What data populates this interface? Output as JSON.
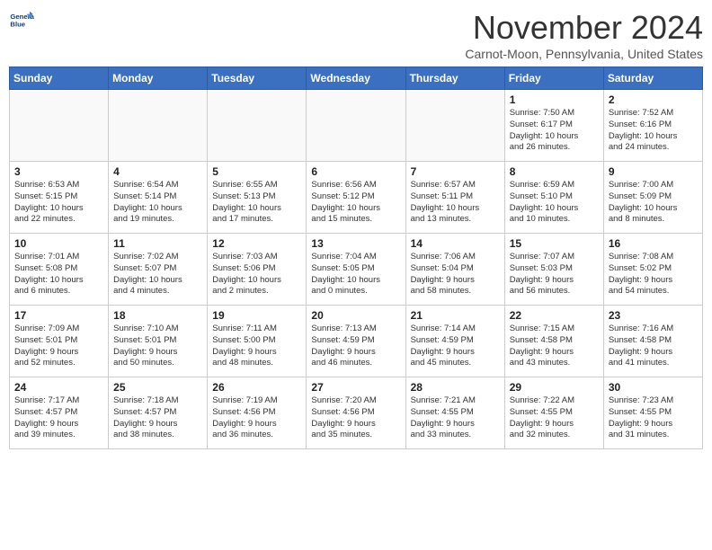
{
  "header": {
    "logo_line1": "General",
    "logo_line2": "Blue",
    "month_title": "November 2024",
    "location": "Carnot-Moon, Pennsylvania, United States"
  },
  "weekdays": [
    "Sunday",
    "Monday",
    "Tuesday",
    "Wednesday",
    "Thursday",
    "Friday",
    "Saturday"
  ],
  "weeks": [
    [
      {
        "day": "",
        "info": ""
      },
      {
        "day": "",
        "info": ""
      },
      {
        "day": "",
        "info": ""
      },
      {
        "day": "",
        "info": ""
      },
      {
        "day": "",
        "info": ""
      },
      {
        "day": "1",
        "info": "Sunrise: 7:50 AM\nSunset: 6:17 PM\nDaylight: 10 hours\nand 26 minutes."
      },
      {
        "day": "2",
        "info": "Sunrise: 7:52 AM\nSunset: 6:16 PM\nDaylight: 10 hours\nand 24 minutes."
      }
    ],
    [
      {
        "day": "3",
        "info": "Sunrise: 6:53 AM\nSunset: 5:15 PM\nDaylight: 10 hours\nand 22 minutes."
      },
      {
        "day": "4",
        "info": "Sunrise: 6:54 AM\nSunset: 5:14 PM\nDaylight: 10 hours\nand 19 minutes."
      },
      {
        "day": "5",
        "info": "Sunrise: 6:55 AM\nSunset: 5:13 PM\nDaylight: 10 hours\nand 17 minutes."
      },
      {
        "day": "6",
        "info": "Sunrise: 6:56 AM\nSunset: 5:12 PM\nDaylight: 10 hours\nand 15 minutes."
      },
      {
        "day": "7",
        "info": "Sunrise: 6:57 AM\nSunset: 5:11 PM\nDaylight: 10 hours\nand 13 minutes."
      },
      {
        "day": "8",
        "info": "Sunrise: 6:59 AM\nSunset: 5:10 PM\nDaylight: 10 hours\nand 10 minutes."
      },
      {
        "day": "9",
        "info": "Sunrise: 7:00 AM\nSunset: 5:09 PM\nDaylight: 10 hours\nand 8 minutes."
      }
    ],
    [
      {
        "day": "10",
        "info": "Sunrise: 7:01 AM\nSunset: 5:08 PM\nDaylight: 10 hours\nand 6 minutes."
      },
      {
        "day": "11",
        "info": "Sunrise: 7:02 AM\nSunset: 5:07 PM\nDaylight: 10 hours\nand 4 minutes."
      },
      {
        "day": "12",
        "info": "Sunrise: 7:03 AM\nSunset: 5:06 PM\nDaylight: 10 hours\nand 2 minutes."
      },
      {
        "day": "13",
        "info": "Sunrise: 7:04 AM\nSunset: 5:05 PM\nDaylight: 10 hours\nand 0 minutes."
      },
      {
        "day": "14",
        "info": "Sunrise: 7:06 AM\nSunset: 5:04 PM\nDaylight: 9 hours\nand 58 minutes."
      },
      {
        "day": "15",
        "info": "Sunrise: 7:07 AM\nSunset: 5:03 PM\nDaylight: 9 hours\nand 56 minutes."
      },
      {
        "day": "16",
        "info": "Sunrise: 7:08 AM\nSunset: 5:02 PM\nDaylight: 9 hours\nand 54 minutes."
      }
    ],
    [
      {
        "day": "17",
        "info": "Sunrise: 7:09 AM\nSunset: 5:01 PM\nDaylight: 9 hours\nand 52 minutes."
      },
      {
        "day": "18",
        "info": "Sunrise: 7:10 AM\nSunset: 5:01 PM\nDaylight: 9 hours\nand 50 minutes."
      },
      {
        "day": "19",
        "info": "Sunrise: 7:11 AM\nSunset: 5:00 PM\nDaylight: 9 hours\nand 48 minutes."
      },
      {
        "day": "20",
        "info": "Sunrise: 7:13 AM\nSunset: 4:59 PM\nDaylight: 9 hours\nand 46 minutes."
      },
      {
        "day": "21",
        "info": "Sunrise: 7:14 AM\nSunset: 4:59 PM\nDaylight: 9 hours\nand 45 minutes."
      },
      {
        "day": "22",
        "info": "Sunrise: 7:15 AM\nSunset: 4:58 PM\nDaylight: 9 hours\nand 43 minutes."
      },
      {
        "day": "23",
        "info": "Sunrise: 7:16 AM\nSunset: 4:58 PM\nDaylight: 9 hours\nand 41 minutes."
      }
    ],
    [
      {
        "day": "24",
        "info": "Sunrise: 7:17 AM\nSunset: 4:57 PM\nDaylight: 9 hours\nand 39 minutes."
      },
      {
        "day": "25",
        "info": "Sunrise: 7:18 AM\nSunset: 4:57 PM\nDaylight: 9 hours\nand 38 minutes."
      },
      {
        "day": "26",
        "info": "Sunrise: 7:19 AM\nSunset: 4:56 PM\nDaylight: 9 hours\nand 36 minutes."
      },
      {
        "day": "27",
        "info": "Sunrise: 7:20 AM\nSunset: 4:56 PM\nDaylight: 9 hours\nand 35 minutes."
      },
      {
        "day": "28",
        "info": "Sunrise: 7:21 AM\nSunset: 4:55 PM\nDaylight: 9 hours\nand 33 minutes."
      },
      {
        "day": "29",
        "info": "Sunrise: 7:22 AM\nSunset: 4:55 PM\nDaylight: 9 hours\nand 32 minutes."
      },
      {
        "day": "30",
        "info": "Sunrise: 7:23 AM\nSunset: 4:55 PM\nDaylight: 9 hours\nand 31 minutes."
      }
    ]
  ]
}
